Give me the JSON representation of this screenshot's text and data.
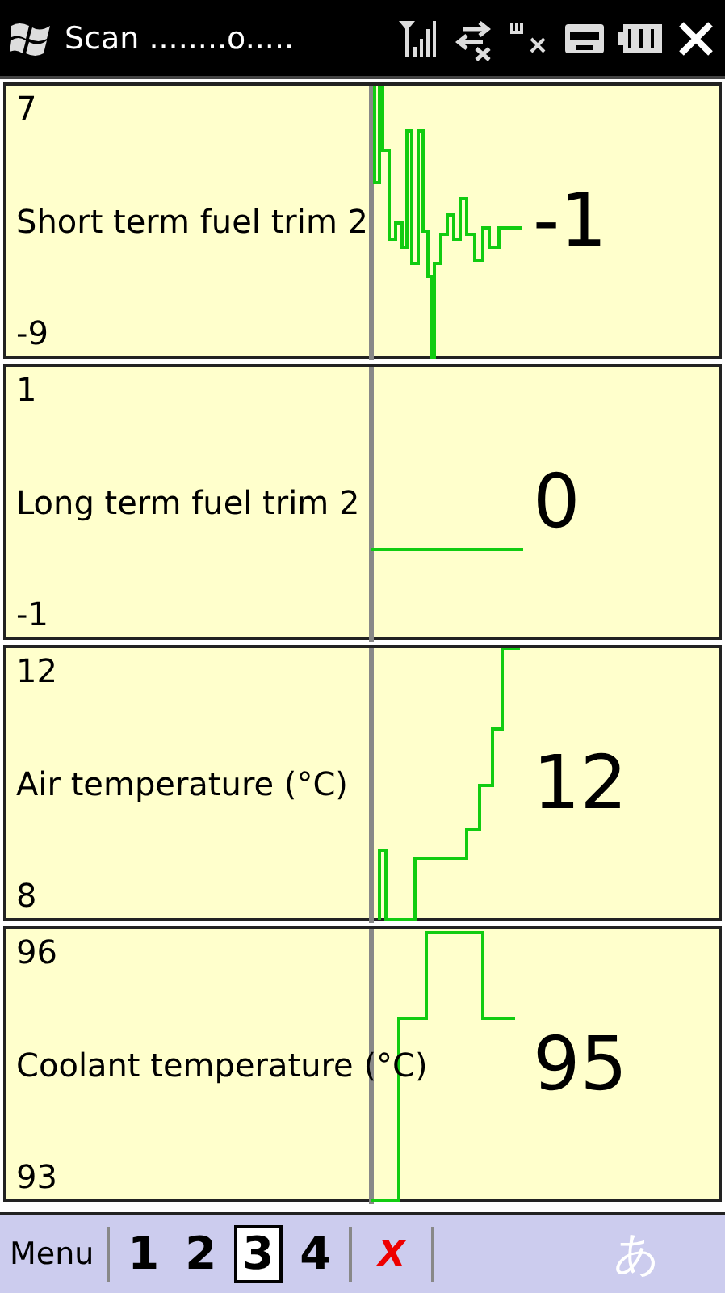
{
  "status_bar": {
    "title": "Scan ........o....."
  },
  "panels": [
    {
      "max": "7",
      "label": "Short term fuel trim 2",
      "min": "-9",
      "value": "-1"
    },
    {
      "max": "1",
      "label": "Long term fuel trim 2",
      "min": "-1",
      "value": "0"
    },
    {
      "max": "12",
      "label": "Air temperature (°C)",
      "min": "8",
      "value": "12"
    },
    {
      "max": "96",
      "label": "Coolant temperature (°C)",
      "min": "93",
      "value": "95"
    }
  ],
  "menu_bar": {
    "menu": "Menu",
    "pages": [
      {
        "label": "1",
        "selected": false
      },
      {
        "label": "2",
        "selected": false
      },
      {
        "label": "3",
        "selected": true
      },
      {
        "label": "4",
        "selected": false
      }
    ],
    "stop": "X",
    "input": "あ"
  }
}
